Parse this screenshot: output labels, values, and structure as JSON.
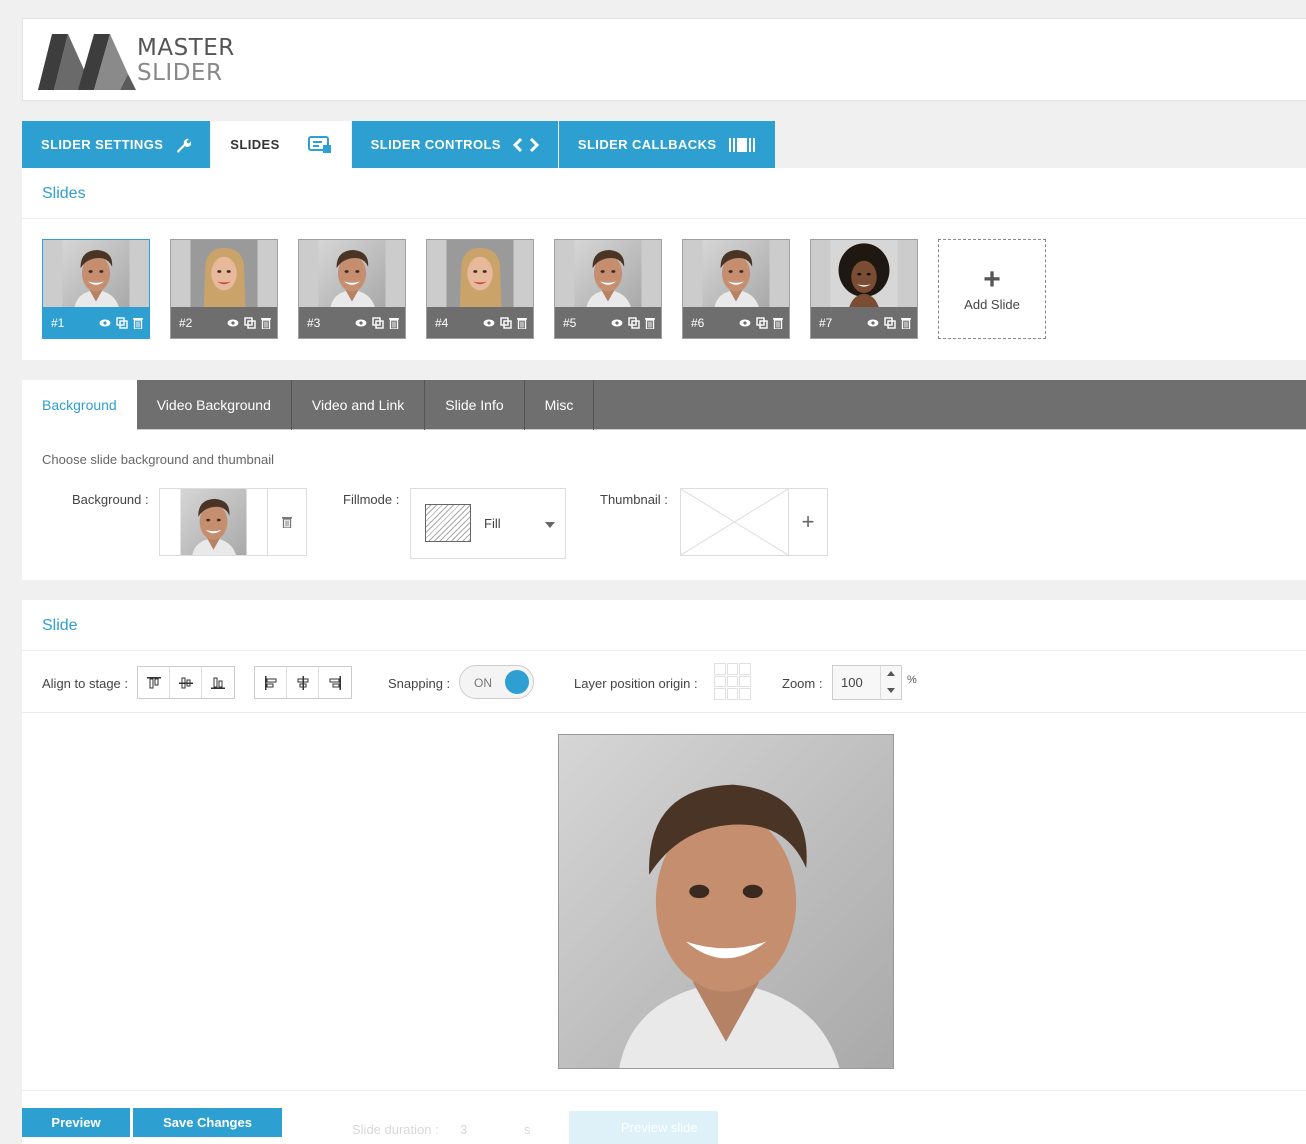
{
  "logo": {
    "line1": "MASTER",
    "line2": "SLIDER"
  },
  "main_tabs": [
    {
      "label": "SLIDER SETTINGS",
      "icon": "wrench-icon"
    },
    {
      "label": "SLIDES",
      "icon": "slides-icon",
      "active": true
    },
    {
      "label": "SLIDER CONTROLS",
      "icon": "arrows-icon"
    },
    {
      "label": "SLIDER CALLBACKS",
      "icon": "callbacks-icon"
    }
  ],
  "slides": {
    "title": "Slides",
    "items": [
      {
        "label": "#1"
      },
      {
        "label": "#2"
      },
      {
        "label": "#3"
      },
      {
        "label": "#4"
      },
      {
        "label": "#5"
      },
      {
        "label": "#6"
      },
      {
        "label": "#7"
      }
    ],
    "add_label": "Add Slide"
  },
  "sub_tabs": [
    "Background",
    "Video Background",
    "Video and Link",
    "Slide Info",
    "Misc"
  ],
  "background": {
    "help": "Choose slide background and thumbnail",
    "bg_label": "Background :",
    "fill_label": "Fillmode :",
    "fill_value": "Fill",
    "thumb_label": "Thumbnail :"
  },
  "slide": {
    "title": "Slide",
    "align_label": "Align to stage :",
    "snapping_label": "Snapping :",
    "snapping_state": "ON",
    "origin_label": "Layer position origin :",
    "zoom_label": "Zoom :",
    "zoom_value": "100",
    "zoom_unit": "%",
    "duration_label": "Slide duration :",
    "duration_value": "3",
    "duration_unit": "s",
    "preview_slide_label": "Preview slide"
  },
  "footer": {
    "preview": "Preview",
    "save": "Save Changes"
  },
  "colors": {
    "accent": "#2e9fd1",
    "tab_dark": "#6f6f6f"
  }
}
